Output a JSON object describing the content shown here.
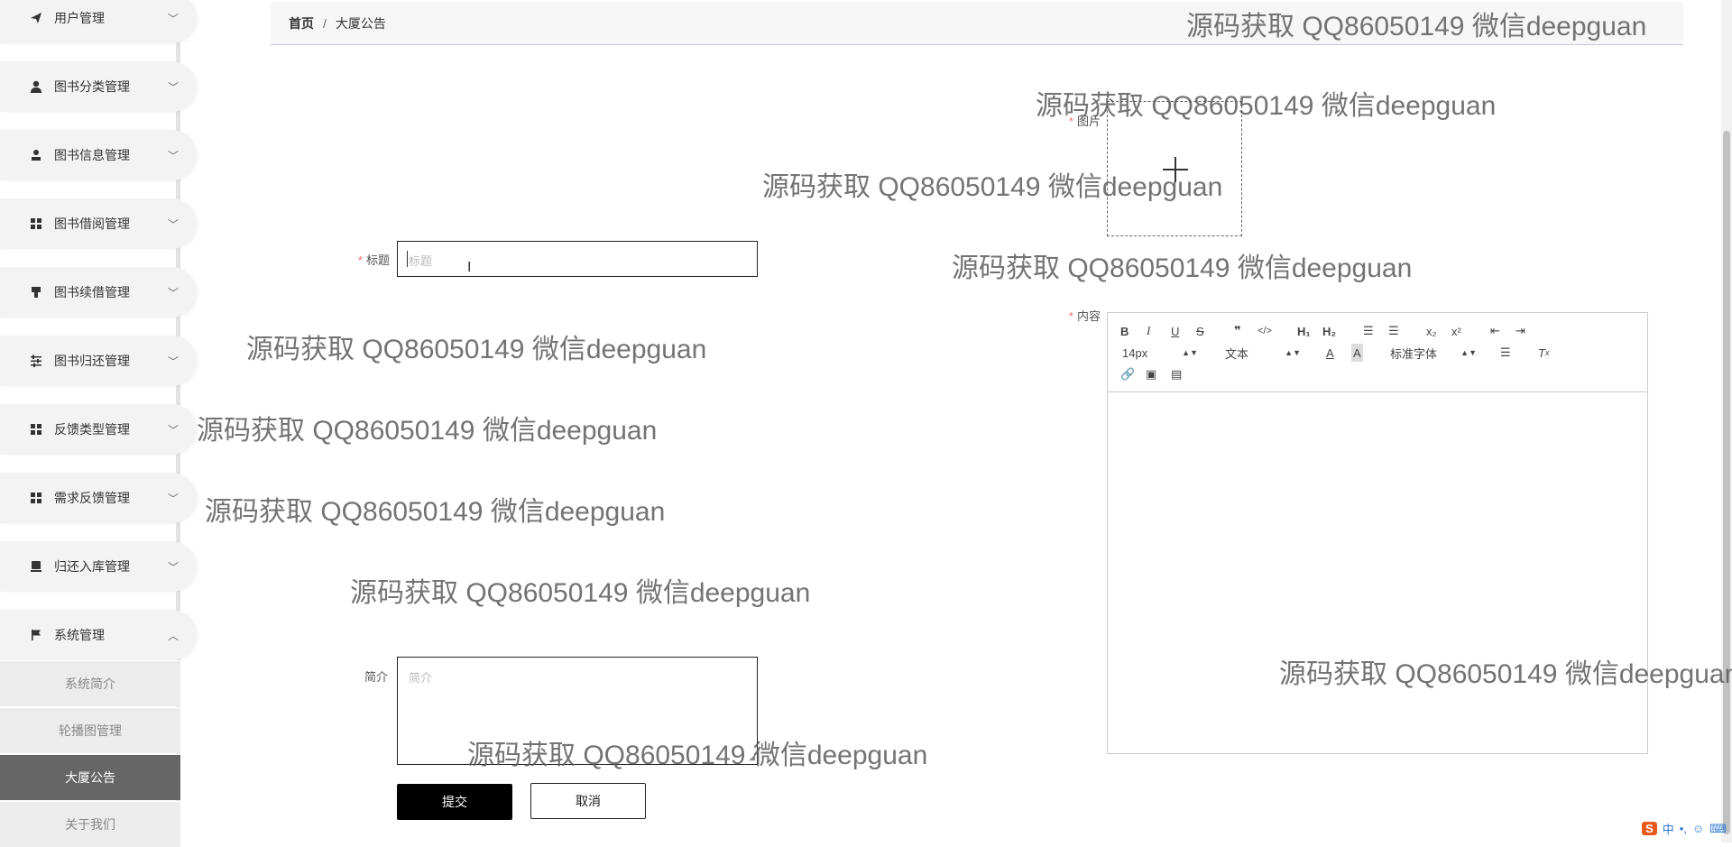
{
  "sidebar": {
    "items": [
      {
        "label": "用户管理",
        "icon": "send-icon"
      },
      {
        "label": "图书分类管理",
        "icon": "user-icon"
      },
      {
        "label": "图书信息管理",
        "icon": "person-icon"
      },
      {
        "label": "图书借阅管理",
        "icon": "grid-icon"
      },
      {
        "label": "图书续借管理",
        "icon": "brush-icon"
      },
      {
        "label": "图书归还管理",
        "icon": "sliders-icon"
      },
      {
        "label": "反馈类型管理",
        "icon": "grid-icon"
      },
      {
        "label": "需求反馈管理",
        "icon": "grid-icon"
      },
      {
        "label": "归还入库管理",
        "icon": "inbox-icon"
      },
      {
        "label": "系统管理",
        "icon": "flag-icon"
      }
    ],
    "submenu": [
      {
        "label": "系统简介"
      },
      {
        "label": "轮播图管理"
      },
      {
        "label": "大厦公告",
        "active": true
      },
      {
        "label": "关于我们"
      }
    ]
  },
  "breadcrumb": {
    "home": "首页",
    "separator": "/",
    "current": "大厦公告"
  },
  "form": {
    "title_label": "标题",
    "title_placeholder": "标题",
    "image_label": "图片",
    "content_label": "内容",
    "intro_label": "简介",
    "intro_placeholder": "简介",
    "submit": "提交",
    "cancel": "取消"
  },
  "editor": {
    "font_size": "14px",
    "header": "文本",
    "font_family": "标准字体"
  },
  "watermark": "源码获取 QQ86050149 微信deepguan",
  "tray": {
    "ime": "中"
  }
}
